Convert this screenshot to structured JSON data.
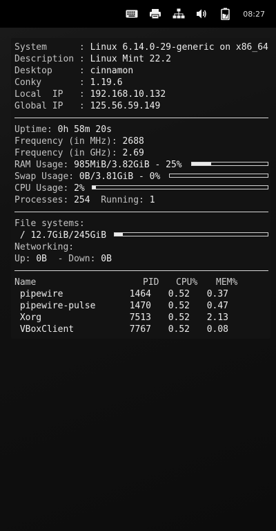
{
  "tray": {
    "icons": [
      "keyboard-icon",
      "printer-icon",
      "network-icon",
      "volume-icon",
      "battery-icon"
    ],
    "clock": "08:27"
  },
  "conky": {
    "system_info": [
      {
        "label": "System     ",
        "value": "Linux 6.14.0-29-generic on x86_64"
      },
      {
        "label": "Description",
        "value": "Linux Mint 22.2"
      },
      {
        "label": "Desktop    ",
        "value": "cinnamon"
      },
      {
        "label": "Conky      ",
        "value": "1.19.6"
      },
      {
        "label": "Local  IP  ",
        "value": "192.168.10.132"
      },
      {
        "label": "Global IP  ",
        "value": "125.56.59.149"
      }
    ],
    "uptime_label": "Uptime: ",
    "uptime": "0h 58m 20s",
    "freq_mhz_label": "Frequency (in MHz): ",
    "freq_mhz": "2688",
    "freq_ghz_label": "Frequency (in GHz): ",
    "freq_ghz": "2.69",
    "ram_label": "RAM Usage: ",
    "ram_value": "985MiB/3.82GiB - 25%",
    "ram_fraction": 0.25,
    "swap_label": "Swap Usage: ",
    "swap_value": "0B/3.81GiB - 0%",
    "swap_fraction": 0.0,
    "cpu_label": "CPU Usage: ",
    "cpu_value": "2%",
    "cpu_fraction": 0.02,
    "processes_label": "Processes: ",
    "processes": "254",
    "running_label": "Running: ",
    "running": "1",
    "fs_label": "File systems:",
    "fs_value": " / 12.7GiB/245GiB",
    "fs_fraction": 0.052,
    "net_label": "Networking:",
    "up_label": "Up: ",
    "up_value": "0B",
    "down_label": "  - Down: ",
    "down_value": "0B",
    "proc_headers": {
      "name": "Name",
      "pid": "PID",
      "cpu": "CPU%",
      "mem": "MEM%"
    },
    "processes_table": [
      {
        "name": " pipewire",
        "pid": "1464",
        "cpu": "0.52",
        "mem": "0.37"
      },
      {
        "name": " pipewire-pulse",
        "pid": "1470",
        "cpu": "0.52",
        "mem": "0.47"
      },
      {
        "name": " Xorg",
        "pid": "7513",
        "cpu": "0.52",
        "mem": "2.13"
      },
      {
        "name": " VBoxClient",
        "pid": "7767",
        "cpu": "0.52",
        "mem": "0.08"
      }
    ]
  }
}
